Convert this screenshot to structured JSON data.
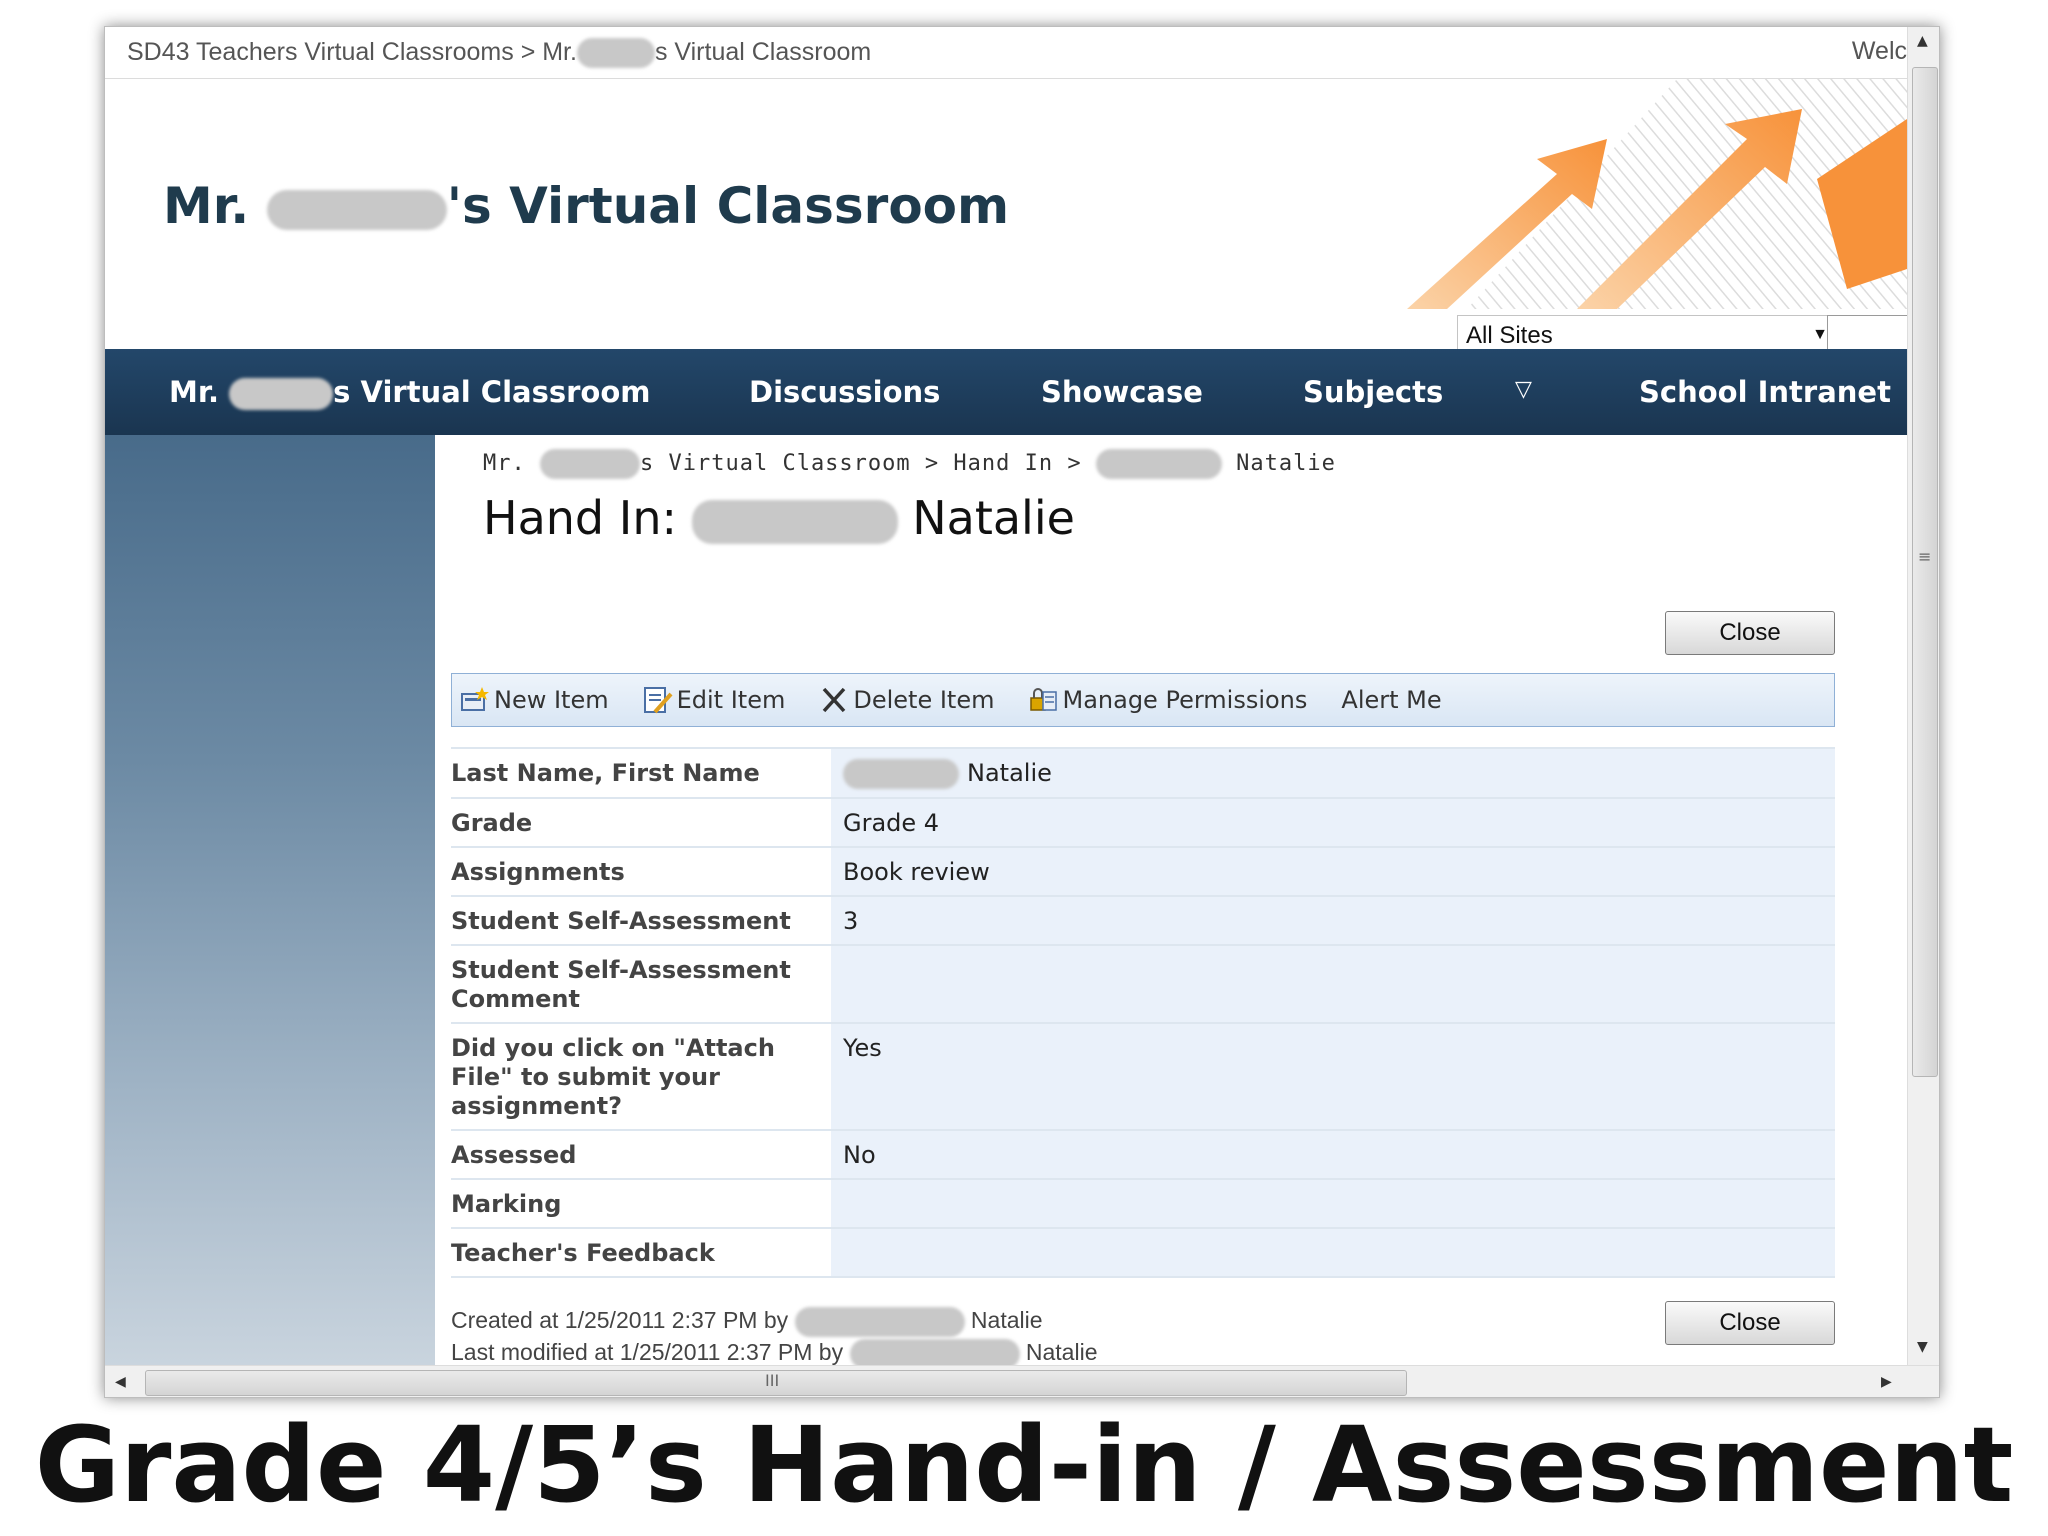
{
  "top_bar": {
    "breadcrumb_part1": "SD43 Teachers Virtual Classrooms > Mr.",
    "breadcrumb_part2": "s Virtual Classroom",
    "welcome": "Welc"
  },
  "header": {
    "title_prefix": "Mr.",
    "title_suffix": "'s Virtual Classroom",
    "search_scope": "All Sites"
  },
  "nav": {
    "home_prefix": "Mr.",
    "home_suffix": "s Virtual Classroom",
    "items": [
      "Discussions",
      "Showcase",
      "Subjects",
      "School Intranet"
    ]
  },
  "content": {
    "breadcrumb_prefix": "Mr.",
    "breadcrumb_middle": "s Virtual Classroom > Hand In >",
    "breadcrumb_suffix": "Natalie",
    "title_prefix": "Hand In:",
    "title_suffix": "Natalie",
    "close_label": "Close",
    "toolbar": {
      "new_item": "New Item",
      "edit_item": "Edit Item",
      "delete_item": "Delete Item",
      "manage_permissions": "Manage Permissions",
      "alert_me": "Alert Me"
    },
    "fields": [
      {
        "label": "Last Name, First Name",
        "value": "Natalie"
      },
      {
        "label": "Grade",
        "value": "Grade 4"
      },
      {
        "label": "Assignments",
        "value": "Book review"
      },
      {
        "label": "Student Self-Assessment",
        "value": "3"
      },
      {
        "label": "Student Self-Assessment Comment",
        "value": ""
      },
      {
        "label": "Did you click on \"Attach File\" to submit your assignment?",
        "value": "Yes"
      },
      {
        "label": "Assessed",
        "value": "No"
      },
      {
        "label": "Marking",
        "value": ""
      },
      {
        "label": "Teacher's Feedback",
        "value": ""
      }
    ],
    "created": "Created at 1/25/2011 2:37 PM  by",
    "created_name": "Natalie",
    "modified": "Last modified at 1/25/2011 2:37 PM  by",
    "modified_name": "Natalie"
  },
  "caption": "Grade 4/5’s Hand-in / Assessment",
  "colors": {
    "nav_bg": "#1e3d59",
    "title": "#1f3b4d",
    "field_value_bg": "#eaf1fa",
    "accent_orange": "#f7923a"
  }
}
